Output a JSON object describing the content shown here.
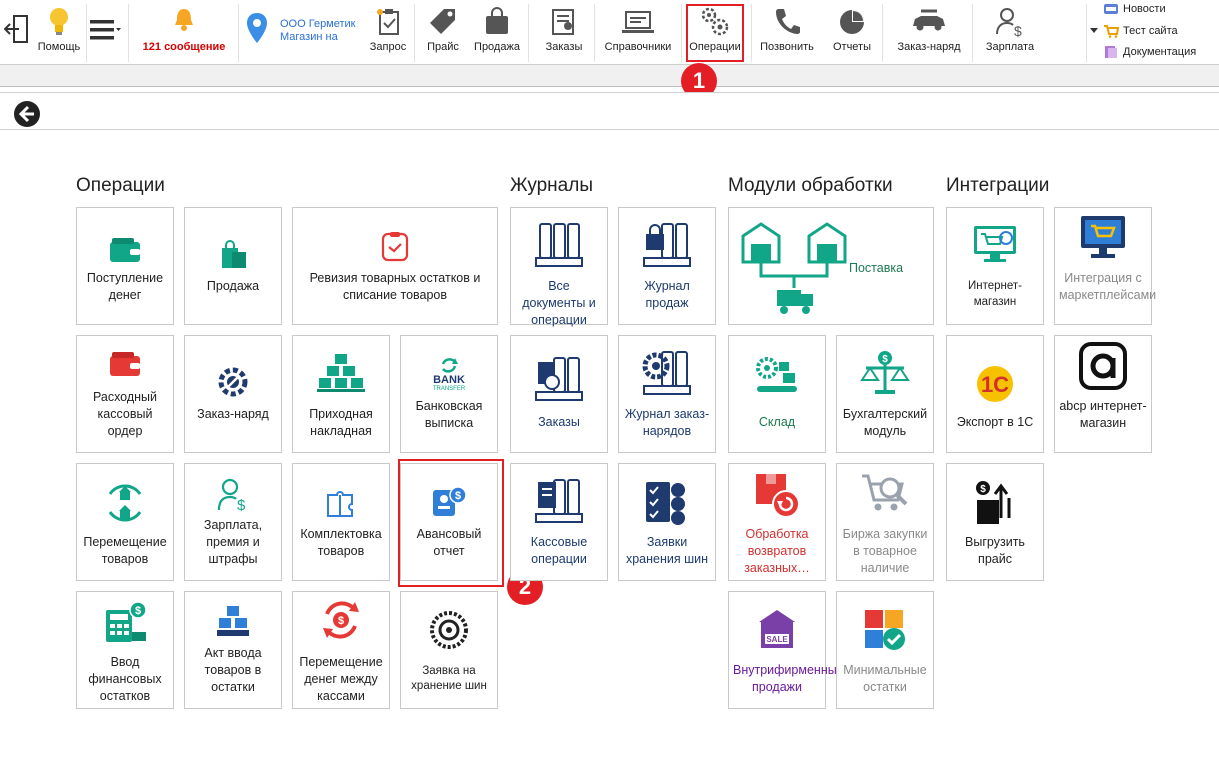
{
  "toolbar": {
    "help": "Помощь",
    "messages": "121 сообщение",
    "org_line1": "ООО Герметик",
    "org_line2": "Магазин на",
    "request": "Запрос",
    "price": "Прайс",
    "sale": "Продажа",
    "orders": "Заказы",
    "references": "Справочники",
    "operations": "Операции",
    "call": "Позвонить",
    "reports": "Отчеты",
    "work_order": "Заказ-наряд",
    "salary": "Зарплата",
    "news": "Новости",
    "test_site": "Тест сайта",
    "docs": "Документация"
  },
  "sections": {
    "operations": "Операции",
    "journals": "Журналы",
    "modules": "Модули обработки",
    "integrations": "Интеграции"
  },
  "tiles": {
    "money_in": "Поступление денег",
    "sale": "Продажа",
    "revision": "Ревизия товарных остатков и списание товаров",
    "cash_out": "Расходный кассовый ордер",
    "work_order": "Заказ-наряд",
    "incoming": "Приходная накладная",
    "bank": "Банковская выписка",
    "bank_icon_line1": "BANK",
    "bank_icon_line2": "TRANSFER",
    "move_goods": "Перемещение товаров",
    "salary": "Зарплата, премия и штрафы",
    "kit": "Комплектовка товаров",
    "advance": "Авансовый отчет",
    "fin_balance": "Ввод финансовых остатков",
    "stock_input": "Акт ввода товаров в остатки",
    "money_move": "Перемещение денег между кассами",
    "tire_request": "Заявка на хранение шин",
    "all_docs": "Все документы и операции",
    "sales_journal": "Журнал продаж",
    "orders": "Заказы",
    "wo_journal": "Журнал заказ-нарядов",
    "cash_ops": "Кассовые операции",
    "tire_requests": "Заявки хранения шин",
    "delivery": "Поставка",
    "warehouse": "Склад",
    "accounting": "Бухгалтерский модуль",
    "returns": "Обработка возвратов заказных…",
    "exchange": "Биржа закупки в товарное наличие",
    "internal_sales": "Внутрифирменные продажи",
    "min_stock": "Минимальные остатки",
    "e_shop": "Интернет-магазин",
    "marketplace": "Интеграция с маркетплейсами",
    "abcp": "abcp интернет-магазин",
    "export_1c": "Экспорт в 1С",
    "price_export": "Выгрузить прайс",
    "sale_badge": "SALE"
  },
  "markers": {
    "one": "1",
    "two": "2"
  },
  "colors": {
    "accent_red": "#e31e24",
    "teal": "#12a689",
    "navy": "#1e3a6e",
    "blue": "#2f7fd8"
  }
}
